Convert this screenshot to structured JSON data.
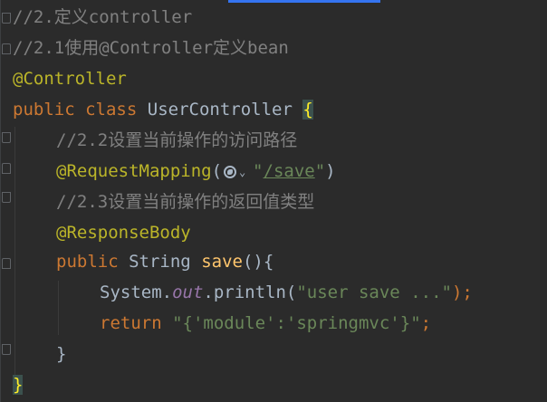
{
  "editor": {
    "lines": {
      "l1": "//2.定义controller",
      "l2": "//2.1使用@Controller定义bean",
      "l3": "@Controller",
      "l4": {
        "kw1": "public",
        "kw2": "class",
        "name": "UserController",
        "brace": "{"
      },
      "l5": "//2.2设置当前操作的访问路径",
      "l6": {
        "annotation": "@RequestMapping",
        "open": "(",
        "quote_open": "\"",
        "path": "/save",
        "quote_close": "\"",
        "close": ")"
      },
      "l7": "//2.3设置当前操作的返回值类型",
      "l8": "@ResponseBody",
      "l9": {
        "kw": "public",
        "type": "String",
        "method": "save",
        "rest": "(){"
      },
      "l10": {
        "obj": "System.",
        "field": "out",
        "call": ".println(",
        "str": "\"user save ...\"",
        "end": ");"
      },
      "l11": {
        "kw": "return",
        "str": "\"{'module':'springmvc'}\"",
        "end": ";"
      },
      "l12": "}",
      "l13": "}"
    },
    "globe_icon": "globe-icon",
    "chevron": "⌄"
  }
}
